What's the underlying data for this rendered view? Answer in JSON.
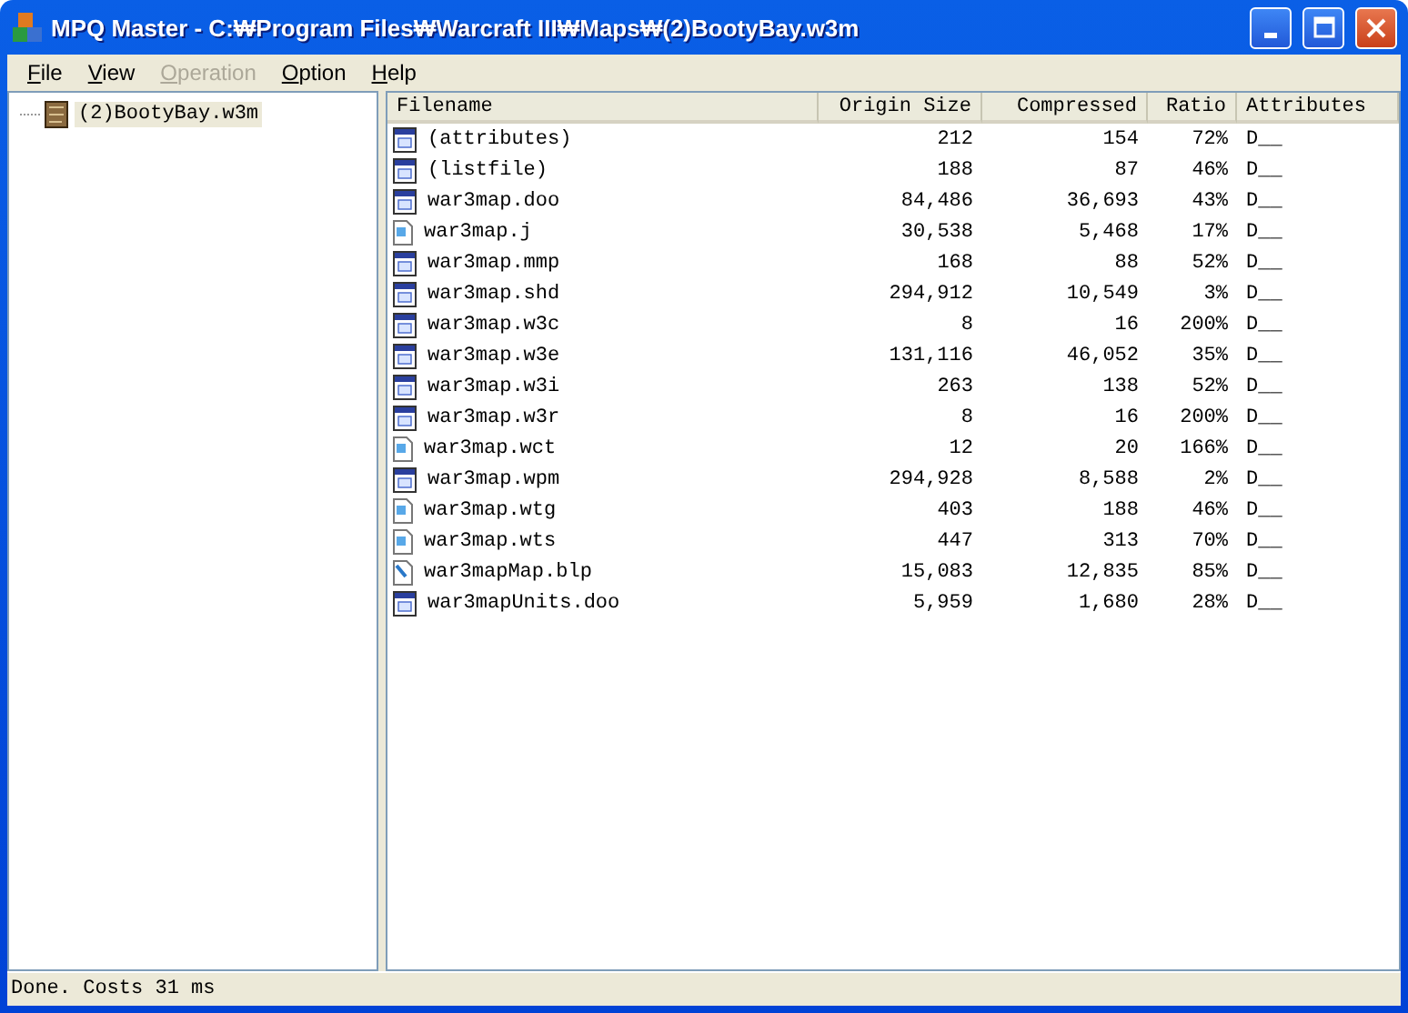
{
  "window": {
    "title": "MPQ Master - C:₩Program Files₩Warcraft III₩Maps₩(2)BootyBay.w3m"
  },
  "menu": [
    {
      "label": "File",
      "disabled": false
    },
    {
      "label": "View",
      "disabled": false
    },
    {
      "label": "Operation",
      "disabled": true
    },
    {
      "label": "Option",
      "disabled": false
    },
    {
      "label": "Help",
      "disabled": false
    }
  ],
  "tree": [
    {
      "label": "(2)BootyBay.w3m",
      "selected": true
    }
  ],
  "table": {
    "columns": [
      "Filename",
      "Origin Size",
      "Compressed",
      "Ratio",
      "Attributes"
    ],
    "rows": [
      {
        "kind": "app",
        "cells": [
          "(attributes)",
          "212",
          "154",
          "72%",
          "D__"
        ]
      },
      {
        "kind": "app",
        "cells": [
          "(listfile)",
          "188",
          "87",
          "46%",
          "D__"
        ]
      },
      {
        "kind": "app",
        "cells": [
          "war3map.doo",
          "84,486",
          "36,693",
          "43%",
          "D__"
        ]
      },
      {
        "kind": "doc",
        "cells": [
          "war3map.j",
          "30,538",
          "5,468",
          "17%",
          "D__"
        ]
      },
      {
        "kind": "app",
        "cells": [
          "war3map.mmp",
          "168",
          "88",
          "52%",
          "D__"
        ]
      },
      {
        "kind": "app",
        "cells": [
          "war3map.shd",
          "294,912",
          "10,549",
          "3%",
          "D__"
        ]
      },
      {
        "kind": "app",
        "cells": [
          "war3map.w3c",
          "8",
          "16",
          "200%",
          "D__"
        ]
      },
      {
        "kind": "app",
        "cells": [
          "war3map.w3e",
          "131,116",
          "46,052",
          "35%",
          "D__"
        ]
      },
      {
        "kind": "app",
        "cells": [
          "war3map.w3i",
          "263",
          "138",
          "52%",
          "D__"
        ]
      },
      {
        "kind": "app",
        "cells": [
          "war3map.w3r",
          "8",
          "16",
          "200%",
          "D__"
        ]
      },
      {
        "kind": "doc",
        "cells": [
          "war3map.wct",
          "12",
          "20",
          "166%",
          "D__"
        ]
      },
      {
        "kind": "app",
        "cells": [
          "war3map.wpm",
          "294,928",
          "8,588",
          "2%",
          "D__"
        ]
      },
      {
        "kind": "doc",
        "cells": [
          "war3map.wtg",
          "403",
          "188",
          "46%",
          "D__"
        ]
      },
      {
        "kind": "doc",
        "cells": [
          "war3map.wts",
          "447",
          "313",
          "70%",
          "D__"
        ]
      },
      {
        "kind": "image",
        "cells": [
          "war3mapMap.blp",
          "15,083",
          "12,835",
          "85%",
          "D__"
        ]
      },
      {
        "kind": "app",
        "cells": [
          "war3mapUnits.doo",
          "5,959",
          "1,680",
          "28%",
          "D__"
        ]
      }
    ]
  },
  "status_bar": "Done. Costs 31 ms"
}
